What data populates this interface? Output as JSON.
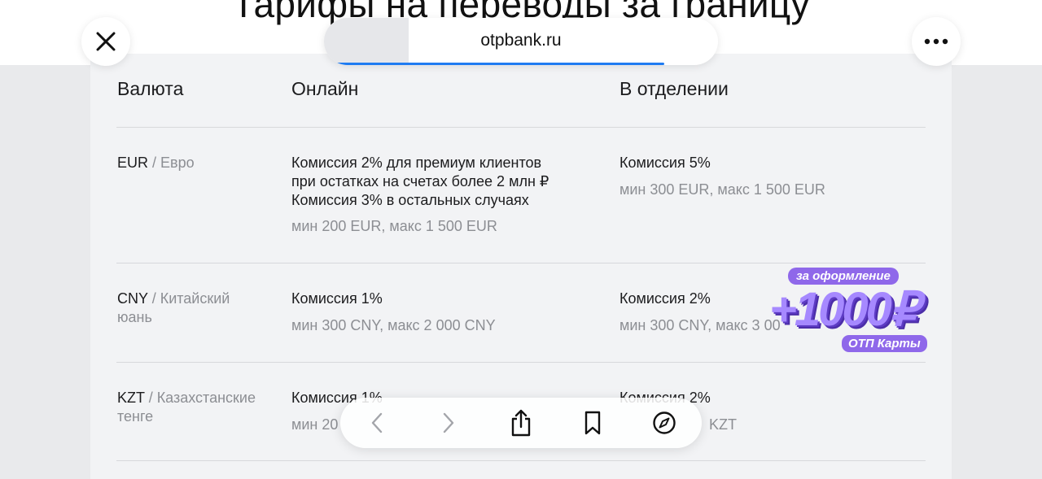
{
  "page": {
    "title": "Тарифы на переводы за границу"
  },
  "browser": {
    "url": "otpbank.ru",
    "close_icon": "close-icon",
    "more_icon": "more-icon",
    "toolbar": [
      "back-icon",
      "forward-icon",
      "share-icon",
      "bookmarks-icon",
      "compass-icon"
    ]
  },
  "table": {
    "headers": {
      "currency": "Валюта",
      "online": "Онлайн",
      "branch": "В отделении"
    },
    "rows": [
      {
        "code": "EUR",
        "name": "/ Евро",
        "online_lines": [
          "Комиссия 2% для премиум клиентов",
          "при остатках на счетах более 2 млн ₽",
          "Комиссия 3% в остальных случаях"
        ],
        "online_limits": "мин 200 EUR, макс 1 500 EUR",
        "branch_commission": "Комиссия 5%",
        "branch_limits": "мин 300 EUR, макс 1 500 EUR"
      },
      {
        "code": "CNY",
        "name": "/ Китайский",
        "name2": "юань",
        "online_commission": "Комиссия 1%",
        "online_limits": "мин 300 CNY, макс 2 000 CNY",
        "branch_commission": "Комиссия 2%",
        "branch_limits": "мин 300 CNY, макс 3 00"
      },
      {
        "code": "KZT",
        "name": "/ Казахстанские",
        "name2": "тенге",
        "online_commission": "Комиссия 1%",
        "online_limits": "мин 20",
        "branch_commission": "Комиссия 2%",
        "branch_limits": "KZT"
      }
    ]
  },
  "promo": {
    "tag": "за оформление",
    "amount": "+1000₽",
    "sub": "ОТП Карты"
  },
  "colors": {
    "accent": "#1f7cf2",
    "promo": "#8f68ea",
    "muted": "#8c8e93"
  }
}
